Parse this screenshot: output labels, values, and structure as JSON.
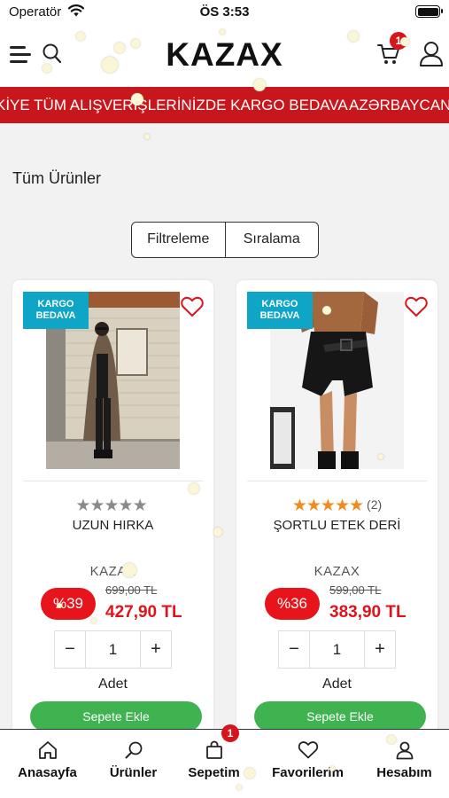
{
  "status_bar": {
    "carrier": "Operatör",
    "time": "ÖS 3:53"
  },
  "header": {
    "logo": "KAZAX",
    "cart_count": "1"
  },
  "marquee": {
    "text_a": "KİYE TÜM ALIŞVERİŞLERİNİZDE KARGO BEDAVA",
    "text_b": "AZƏRBAYCAN"
  },
  "page": {
    "title": "Tüm Ürünler",
    "filter_label": "Filtreleme",
    "sort_label": "Sıralama"
  },
  "colors": {
    "brand_red": "#c8161d",
    "shipping_badge": "#0ea5c6",
    "add_to_cart": "#3fb34f",
    "star_gold": "#f08c1e"
  },
  "products": [
    {
      "badge": "KARGO BEDAVA",
      "badge_line1": "KARGO",
      "badge_line2": "BEDAVA",
      "rating": 0,
      "review_count": "",
      "name": "UZUN HIRKA",
      "brand": "KAZAX",
      "discount": "%39",
      "old_price": "699,00 TL",
      "price": "427,90 TL",
      "quantity": "1",
      "unit": "Adet",
      "add_label": "Sepete Ekle"
    },
    {
      "badge": "KARGO BEDAVA",
      "badge_line1": "KARGO",
      "badge_line2": "BEDAVA",
      "rating": 5,
      "review_count": "(2)",
      "name": "ŞORTLU ETEK DERİ",
      "brand": "KAZAX",
      "discount": "%36",
      "old_price": "599,00 TL",
      "price": "383,90 TL",
      "quantity": "1",
      "unit": "Adet",
      "add_label": "Sepete Ekle"
    }
  ],
  "tabbar": {
    "tabs": [
      {
        "label": "Anasayfa",
        "icon": "home-icon"
      },
      {
        "label": "Ürünler",
        "icon": "search-icon"
      },
      {
        "label": "Sepetim",
        "icon": "bag-icon"
      },
      {
        "label": "Favorilerim",
        "icon": "heart-icon"
      },
      {
        "label": "Hesabım",
        "icon": "user-icon"
      }
    ],
    "cart_badge": "1"
  }
}
